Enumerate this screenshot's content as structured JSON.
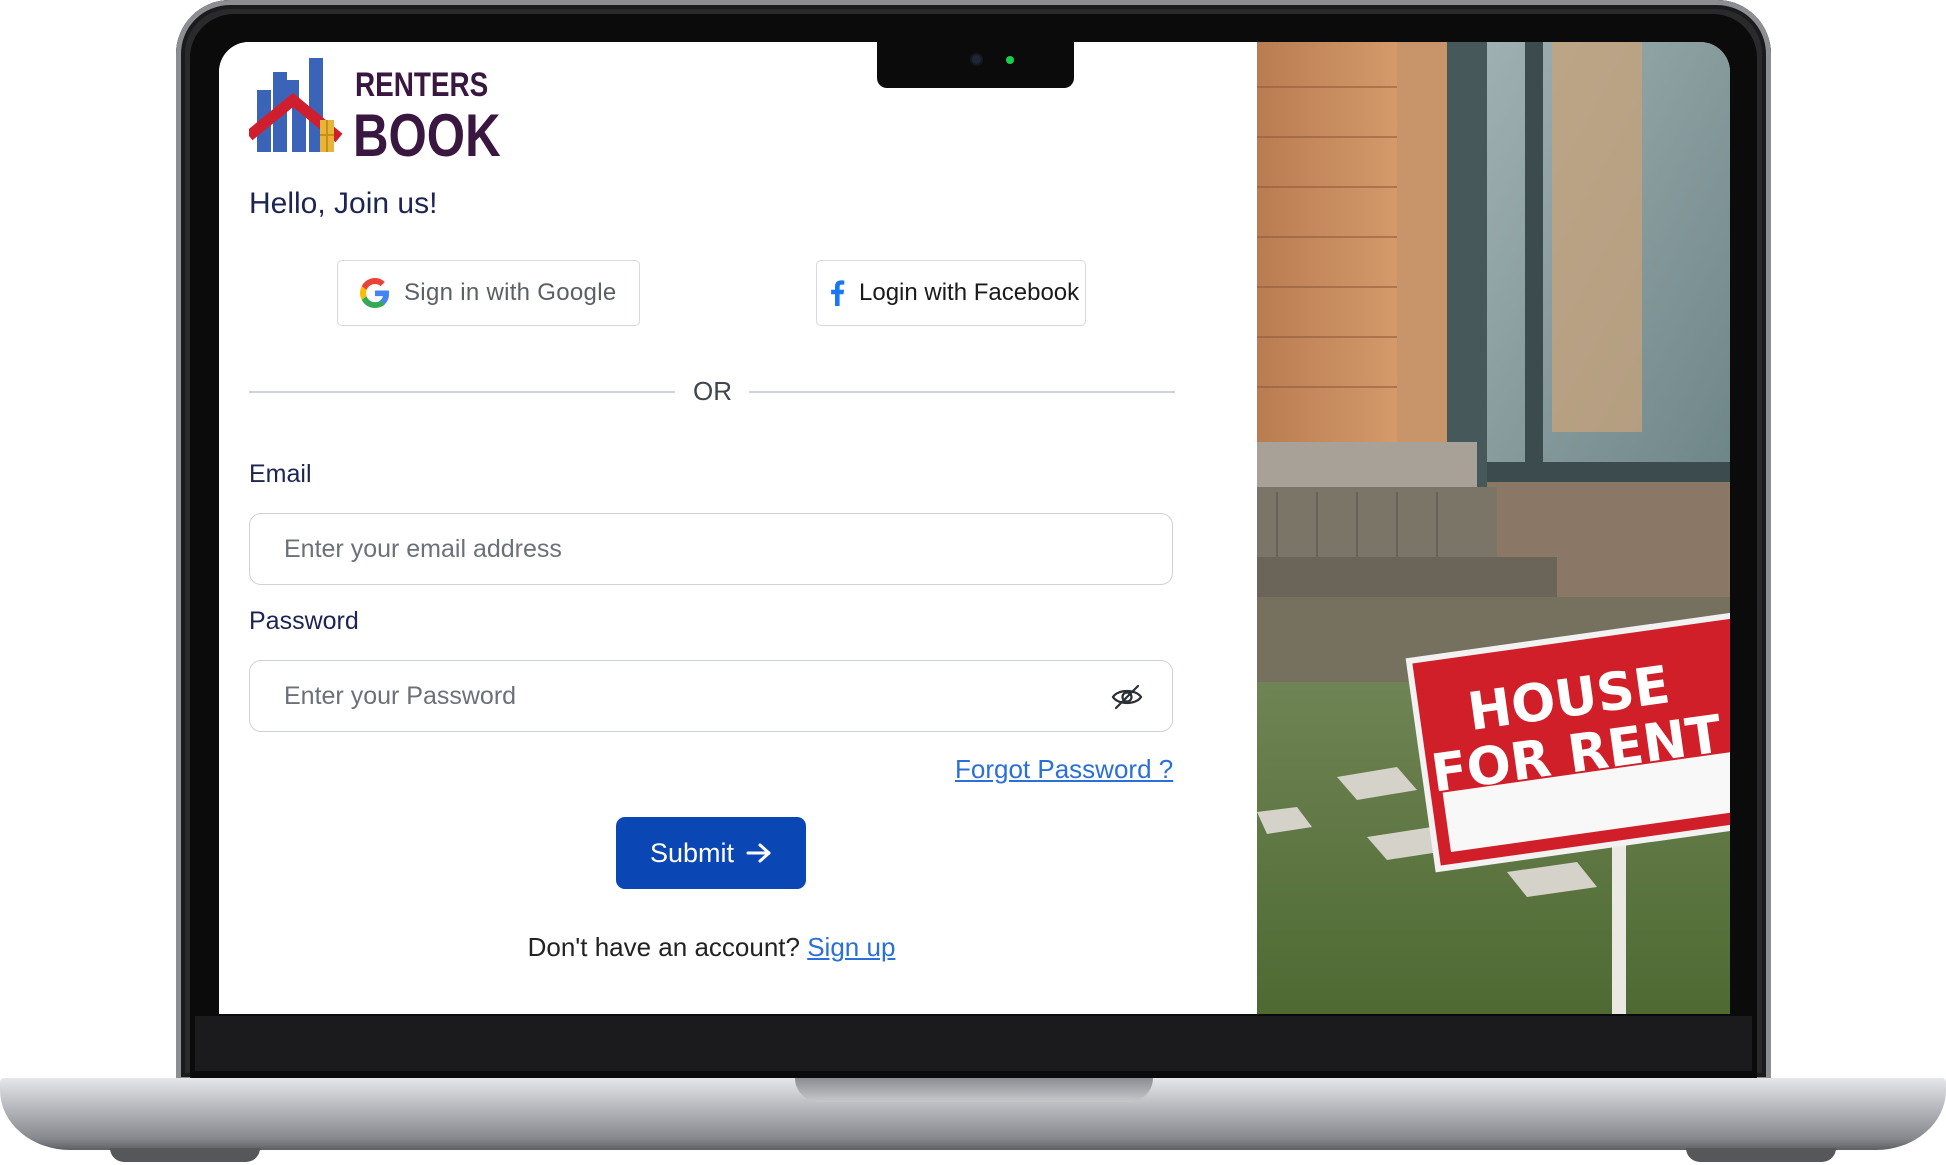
{
  "brand": {
    "name_top": "RENTERS",
    "name_bottom": "BOOK",
    "colors": {
      "blue": "#3b64b8",
      "red": "#cf1f2e",
      "dark": "#3a1740",
      "door": "#e7b43a"
    }
  },
  "greeting": "Hello, Join us!",
  "social": {
    "google_label": "Sign in with Google",
    "google_icon": "google-g-icon",
    "facebook_label": "Login with Facebook",
    "facebook_icon": "facebook-f-icon"
  },
  "divider_text": "OR",
  "form": {
    "email_label": "Email",
    "email_value": "",
    "email_placeholder": "Enter your email address",
    "password_label": "Password",
    "password_value": "",
    "password_placeholder": "Enter your Password",
    "password_toggle_icon": "eye-slash-icon",
    "forgot_link": "Forgot Password ?",
    "submit_label": "Submit",
    "submit_icon": "arrow-right-icon"
  },
  "signup": {
    "prompt": "Don't have an account?",
    "link": "Sign up"
  },
  "photo": {
    "sign_line1": "HOUSE",
    "sign_line2": "FOR RENT"
  },
  "theme": {
    "primary_button": "#0b47b4",
    "link": "#2b6fd9",
    "heading_text": "#1b2452",
    "status_led": "#14d04a"
  }
}
